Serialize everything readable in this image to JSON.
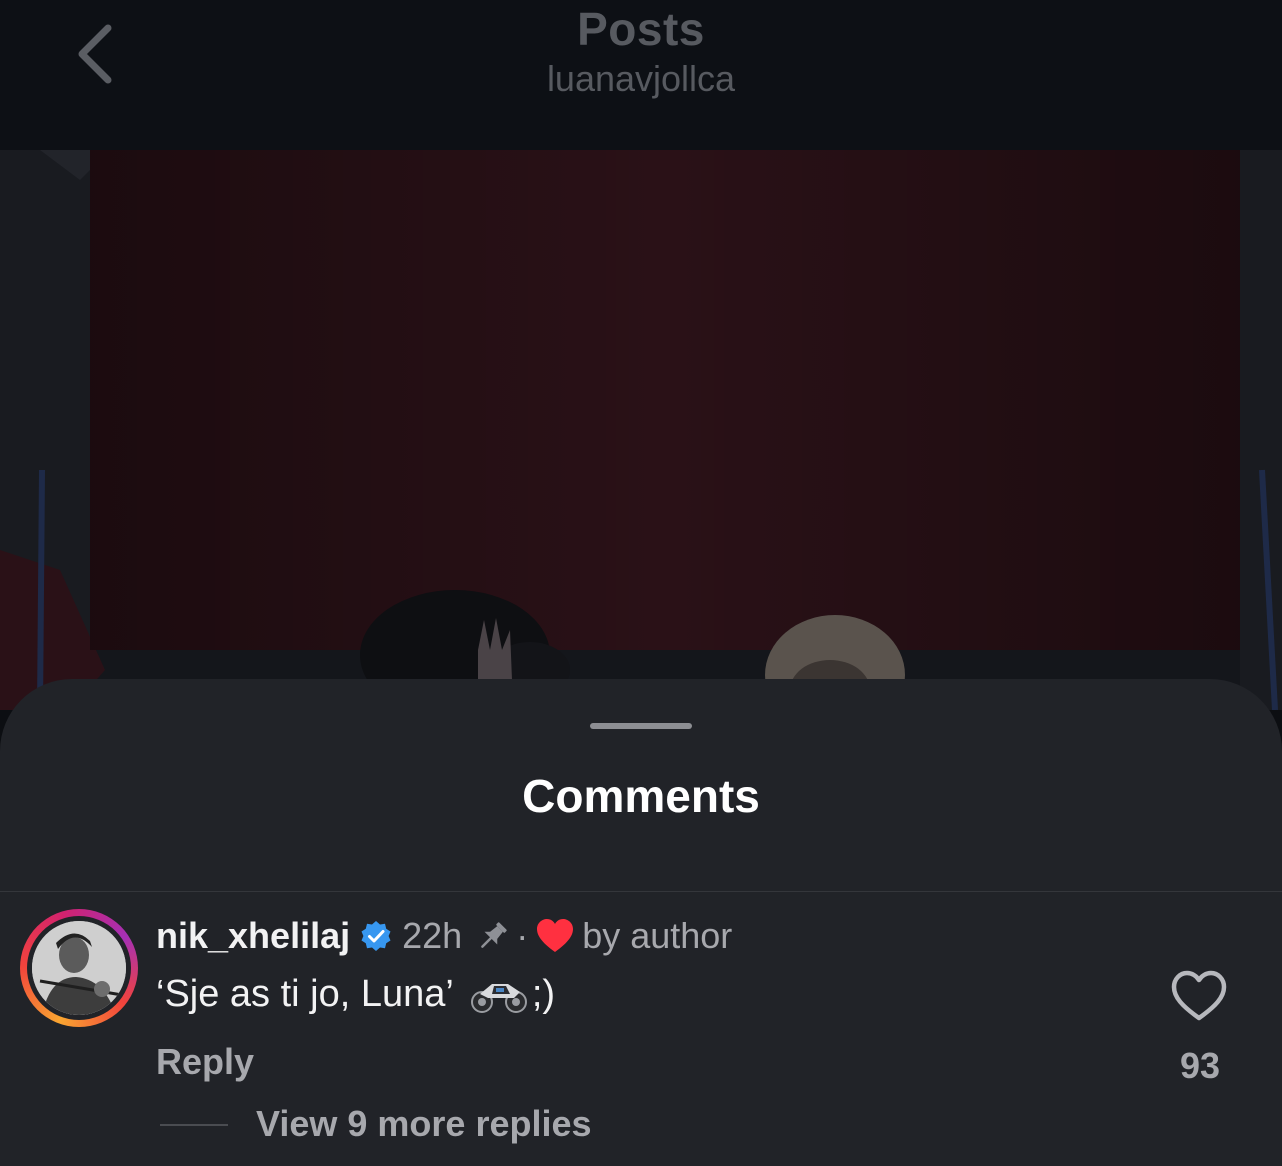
{
  "header": {
    "title": "Posts",
    "subtitle": "luanavjollca",
    "back_icon": "chevron-left-icon"
  },
  "sheet": {
    "title": "Comments"
  },
  "comment": {
    "username": "nik_xhelilaj",
    "verified_icon": "verified-badge-icon",
    "time": "22h",
    "pin_icon": "pin-icon",
    "separator": "·",
    "liked_by_author_icon": "heart-icon",
    "liked_by_author_label": "by author",
    "text": "‘Sje as ti jo, Luna’",
    "emoji_icon": "motorcycle-icon",
    "text_suffix": ";)",
    "reply_label": "Reply",
    "like_count": "93",
    "view_replies_label": "View 9 more replies"
  },
  "colors": {
    "background": "#0c0e12",
    "sheet": "#212328",
    "primary_text": "#f2f2f3",
    "secondary_text": "#a7a8ad",
    "verified_blue": "#3797f0",
    "heart_red": "#ff3040"
  }
}
